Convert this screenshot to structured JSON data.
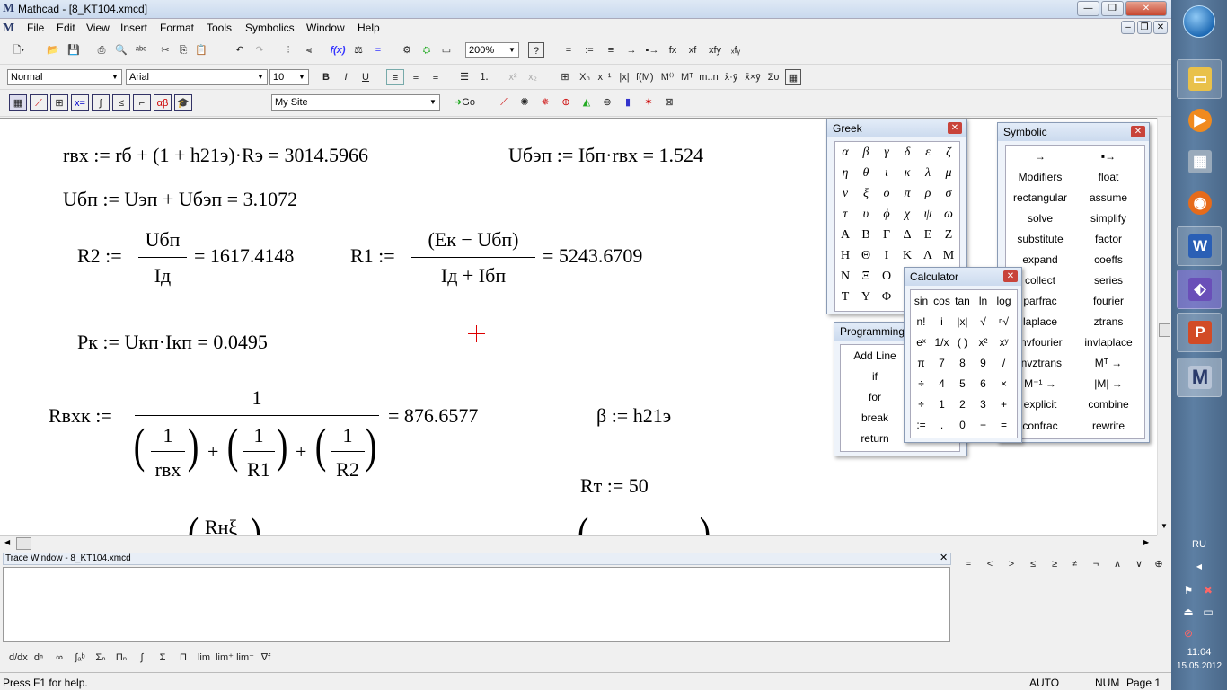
{
  "window": {
    "title": "Mathcad - [8_KT104.xmcd]",
    "app_icon": "M"
  },
  "menu": [
    "File",
    "Edit",
    "View",
    "Insert",
    "Format",
    "Tools",
    "Symbolics",
    "Window",
    "Help"
  ],
  "toolbar": {
    "zoom": "200%"
  },
  "format": {
    "style": "Normal",
    "font": "Arial",
    "size": "10"
  },
  "resources": {
    "site": "My Site",
    "go_label": "Go"
  },
  "worksheet": {
    "eq1_lhs": "rвх := rб + (1 + h21э)·Rэ = 3014.5966",
    "eq2": "Uбэп := Iбп·rвх = 1.524",
    "eq3": "Uбп := Uэп + Uбэп = 3.1072",
    "eq4_lhs": "R2 :=",
    "eq4_num": "Uбп",
    "eq4_den": "Iд",
    "eq4_res": "= 1617.4148",
    "eq5_lhs": "R1 :=",
    "eq5_num": "(Eк − Uбп)",
    "eq5_den": "Iд + Iбп",
    "eq5_res": "= 5243.6709",
    "eq6": "Pк := Uкп·Iкп = 0.0495",
    "eq7_lhs": "Rвхк :=",
    "eq7_num": "1",
    "eq7_res": "= 876.6577",
    "eq7_terms": [
      {
        "num": "1",
        "den": "rвх"
      },
      {
        "num": "1",
        "den": "R1"
      },
      {
        "num": "1",
        "den": "R2"
      }
    ],
    "eq8": "β := h21э",
    "eq9": "Rт := 50",
    "eq10_partial": "Rнξ"
  },
  "greek": {
    "title": "Greek",
    "lower": [
      "α",
      "β",
      "γ",
      "δ",
      "ε",
      "ζ",
      "η",
      "θ",
      "ι",
      "κ",
      "λ",
      "μ",
      "ν",
      "ξ",
      "ο",
      "π",
      "ρ",
      "σ",
      "τ",
      "υ",
      "ϕ",
      "χ",
      "ψ",
      "ω"
    ],
    "upper": [
      "Α",
      "Β",
      "Γ",
      "Δ",
      "Ε",
      "Ζ",
      "Η",
      "Θ",
      "Ι",
      "Κ",
      "Λ",
      "Μ",
      "Ν",
      "Ξ",
      "Ο",
      "Τ",
      "Υ",
      "Φ"
    ]
  },
  "symbolic": {
    "title": "Symbolic",
    "items": [
      "→",
      "▪→",
      "Modifiers",
      "float",
      "rectangular",
      "assume",
      "solve",
      "simplify",
      "substitute",
      "factor",
      "expand",
      "coeffs",
      "collect",
      "series",
      "parfrac",
      "fourier",
      "laplace",
      "ztrans",
      "invfourier",
      "invlaplace",
      "invztrans",
      "Mᵀ →",
      "M⁻¹ →",
      "|M| →",
      "explicit",
      "combine",
      "confrac",
      "rewrite"
    ]
  },
  "programming": {
    "title": "Programming",
    "items": [
      "Add Line",
      "if",
      "for",
      "break",
      "return"
    ]
  },
  "calculator": {
    "title": "Calculator",
    "keys": [
      "sin",
      "cos",
      "tan",
      "ln",
      "log",
      "n!",
      "i",
      "|x|",
      "√",
      "ⁿ√",
      "eˣ",
      "1/x",
      "( )",
      "x²",
      "xʸ",
      "π",
      "7",
      "8",
      "9",
      "/",
      "÷",
      "4",
      "5",
      "6",
      "×",
      "÷",
      "1",
      "2",
      "3",
      "+",
      ":=",
      ".",
      "0",
      "−",
      "="
    ]
  },
  "trace": {
    "title": "Trace Window - 8_KT104.xmcd"
  },
  "boolean": [
    "=",
    "<",
    ">",
    "≤",
    "≥",
    "≠",
    "¬",
    "∧",
    "∨",
    "⊕"
  ],
  "status": {
    "help": "Press F1 for help.",
    "mode": "AUTO",
    "num": "NUM",
    "page": "Page 1"
  },
  "tray": {
    "lang": "RU",
    "time": "11:04",
    "date": "15.05.2012"
  }
}
